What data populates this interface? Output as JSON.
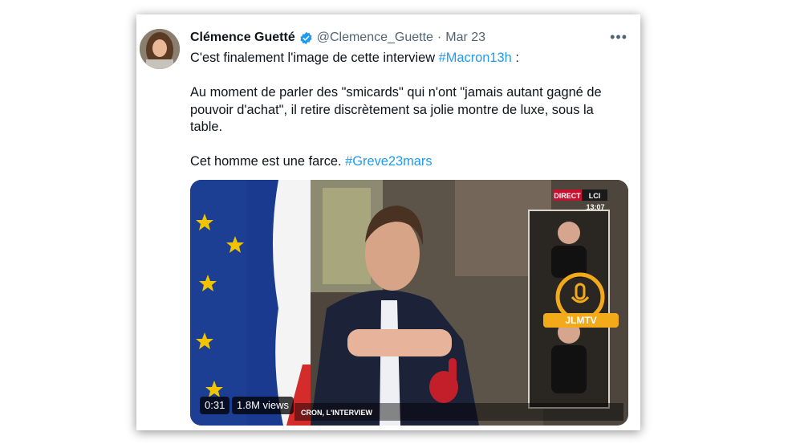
{
  "tweet": {
    "author_name": "Clémence Guetté",
    "handle": "@Clemence_Guette",
    "separator": "·",
    "date": "Mar 23",
    "more_label": "•••",
    "line1_text": "C'est finalement l'image de cette interview ",
    "line1_hashtag": "#Macron13h",
    "line1_suffix": " :",
    "paragraph2": "Au moment de parler des \"smicards\" qui n'ont \"jamais autant gagné de pouvoir d'achat\", il retire discrètement sa jolie montre de luxe, sous la table.",
    "line3_text": "Cet homme est une farce. ",
    "line3_hashtag": "#Greve23mars"
  },
  "video": {
    "duration": "0:31",
    "views": "1.8M views",
    "broadcast_badge": "DIRECT",
    "channel": "LCI",
    "time": "13:07",
    "caption": "CRON, L'INTERVIEW",
    "watermark": "JLMTV"
  },
  "colors": {
    "accent": "#1d9bf0",
    "text": "#0f1419",
    "muted": "#536471",
    "verified": "#1d9bf0"
  },
  "icons": [
    "verified-badge-icon",
    "more-options-icon",
    "microphone-logo-icon",
    "foam-finger-icon"
  ]
}
